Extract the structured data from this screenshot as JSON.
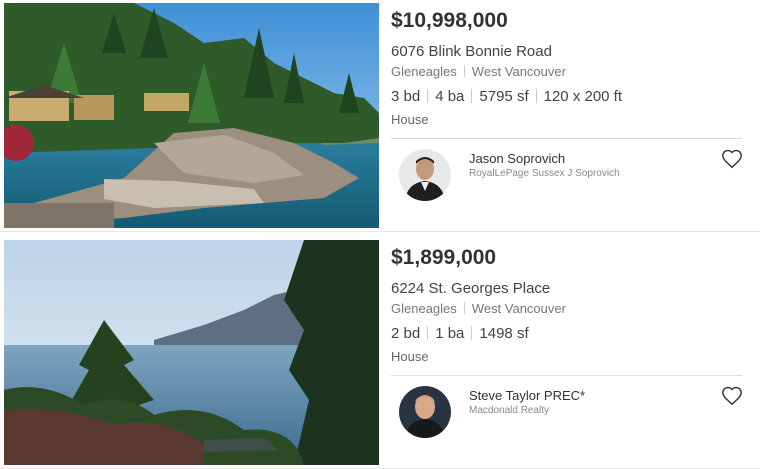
{
  "listings": [
    {
      "price": "$10,998,000",
      "address": "6076 Blink Bonnie Road",
      "neighbourhood": "Gleneagles",
      "city": "West Vancouver",
      "specs": [
        "3 bd",
        "4 ba",
        "5795 sf",
        "120 x 200 ft"
      ],
      "type": "House",
      "agent": {
        "name": "Jason Soprovich",
        "brokerage": "RoyalLePage Sussex J Soprovich"
      },
      "favorite_icon": "heart-outline-icon"
    },
    {
      "price": "$1,899,000",
      "address": "6224 St. Georges Place",
      "neighbourhood": "Gleneagles",
      "city": "West Vancouver",
      "specs": [
        "2 bd",
        "1 ba",
        "1498 sf"
      ],
      "type": "House",
      "agent": {
        "name": "Steve Taylor PREC*",
        "brokerage": "Macdonald Realty"
      },
      "favorite_icon": "heart-outline-icon"
    }
  ]
}
